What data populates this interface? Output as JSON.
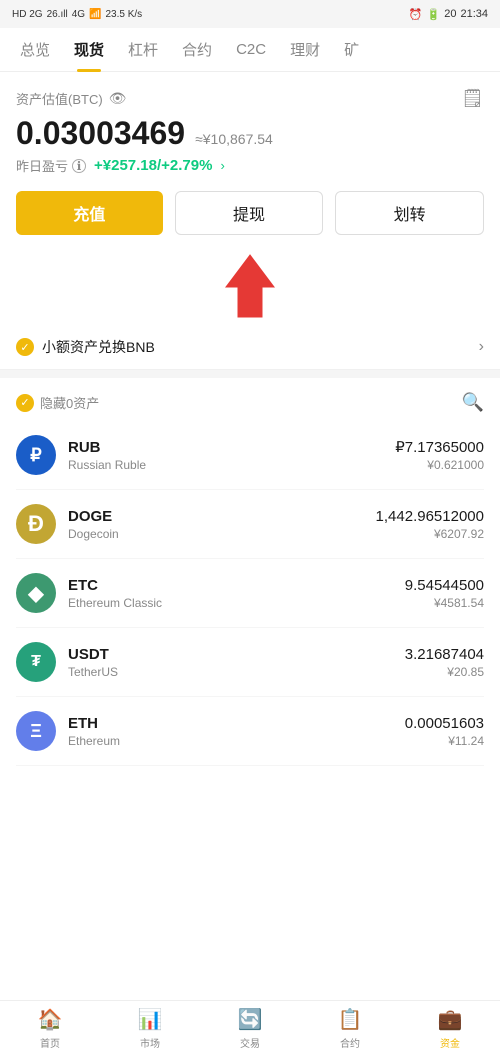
{
  "statusBar": {
    "left": "HD 2G 26. 4G",
    "signal": "📶",
    "time": "21:34",
    "battery": "20",
    "speed": "23.5 K/s"
  },
  "navTabs": [
    {
      "id": "overview",
      "label": "总览",
      "active": false
    },
    {
      "id": "spot",
      "label": "现货",
      "active": true
    },
    {
      "id": "leverage",
      "label": "杠杆",
      "active": false
    },
    {
      "id": "contract",
      "label": "合约",
      "active": false
    },
    {
      "id": "c2c",
      "label": "C2C",
      "active": false
    },
    {
      "id": "finance",
      "label": "理财",
      "active": false
    },
    {
      "id": "mining",
      "label": "矿",
      "active": false
    }
  ],
  "asset": {
    "label": "资产估值(BTC)",
    "btcAmount": "0.03003469",
    "cnyApprox": "≈¥10,867.54",
    "pnlLabel": "昨日盈亏",
    "pnlValue": "+¥257.18/+2.79%"
  },
  "buttons": {
    "deposit": "充值",
    "withdraw": "提现",
    "transfer": "划转"
  },
  "bnbBanner": {
    "text": "小额资产兑换BNB"
  },
  "assetList": {
    "hideZeroLabel": "隐藏0资产",
    "coins": [
      {
        "symbol": "RUB",
        "name": "Russian Ruble",
        "iconBg": "#1a5dc8",
        "iconText": "₽",
        "amount": "₽7.17365000",
        "cny": "¥0.621000"
      },
      {
        "symbol": "DOGE",
        "name": "Dogecoin",
        "iconBg": "#c2a633",
        "iconText": "Ð",
        "amount": "1,442.96512000",
        "cny": "¥6207.92"
      },
      {
        "symbol": "ETC",
        "name": "Ethereum Classic",
        "iconBg": "#3d9970",
        "iconText": "◆",
        "amount": "9.54544500",
        "cny": "¥4581.54"
      },
      {
        "symbol": "USDT",
        "name": "TetherUS",
        "iconBg": "#26a17b",
        "iconText": "₮",
        "amount": "3.21687404",
        "cny": "¥20.85"
      },
      {
        "symbol": "ETH",
        "name": "Ethereum",
        "iconBg": "#627eea",
        "iconText": "Ξ",
        "amount": "0.00051603",
        "cny": "¥11.24"
      }
    ]
  },
  "bottomNav": [
    {
      "id": "home",
      "icon": "🏠",
      "label": "首页",
      "active": false
    },
    {
      "id": "market",
      "icon": "📊",
      "label": "市场",
      "active": false
    },
    {
      "id": "trade",
      "icon": "🔄",
      "label": "交易",
      "active": false
    },
    {
      "id": "contract",
      "icon": "📋",
      "label": "合约",
      "active": false
    },
    {
      "id": "assets",
      "icon": "💼",
      "label": "资金",
      "active": true
    }
  ]
}
